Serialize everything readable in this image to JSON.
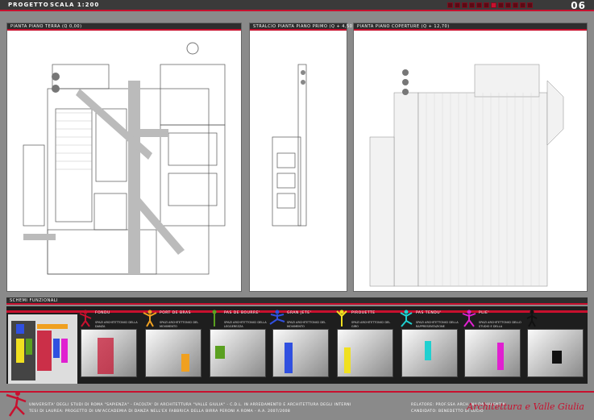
{
  "header": {
    "title": "PROGETTO",
    "scale": "SCALA 1:200",
    "page_number": "06"
  },
  "panels": {
    "ground_floor": "PIANTA PIANO TERRA (Q 0,00)",
    "mezzanine": "STRALCIO PIANTA PIANO PRIMO (Q + 4,50)",
    "roof": "PIANTA PIANO COPERTURE (Q + 12,70)"
  },
  "functional": {
    "title": "SCHEMI FUNZIONALI",
    "items": [
      {
        "label": "FONDU",
        "desc": "SPAZI ARCHITETTONICI DELLA DANZA",
        "color": "#c8102e"
      },
      {
        "label": "PORT DE BRAS",
        "desc": "SPAZI ARCHITETTONICI DEL MOVIMENTO",
        "color": "#f0a020"
      },
      {
        "label": "PAS DE BOURRE'",
        "desc": "SPAZI ARCHITETTONICI DELLA LEGGEREZZA",
        "color": "#5aa020"
      },
      {
        "label": "GRAN JETE'",
        "desc": "SPAZI ARCHITETTONICI DEL MOVIMENTO",
        "color": "#3050e0"
      },
      {
        "label": "PIROUETTE",
        "desc": "SPAZI ARCHITETTONICI DEL GIRO",
        "color": "#f0e020"
      },
      {
        "label": "PAS TENDU'",
        "desc": "SPAZI ARCHITETTONICI DELLA RAPPRESENTAZIONE",
        "color": "#20d0d0"
      },
      {
        "label": "PLIE'",
        "desc": "SPAZI ARCHITETTONICI DELLO STUDIO E DELLA SPERIMENTAZIONE",
        "color": "#e020d0"
      },
      {
        "label": "",
        "desc": "",
        "color": "#111111"
      }
    ]
  },
  "footer": {
    "line1": "UNIVERSITA' DEGLI STUDI DI ROMA \"SAPIENZA\" - FACOLTA' DI ARCHITETTURA \"VALLE GIULIA\" - C.D.L. IN ARREDAMENTO E ARCHITETTURA DEGLI INTERNI",
    "line2": "TESI DI LAUREA: PROGETTO DI UN'ACCADEMIA DI DANZA NELL'EX FABBRICA DELLA BIRRA PERONI A ROMA - A.A. 2007/2008",
    "relatore": "RELATORE: PROF.SSA ARCH. NILDA VALENTIN",
    "candidato": "CANDIDATO: BENEDETTO DI LUCIO",
    "signature": "Architettura e Valle Giulia"
  }
}
